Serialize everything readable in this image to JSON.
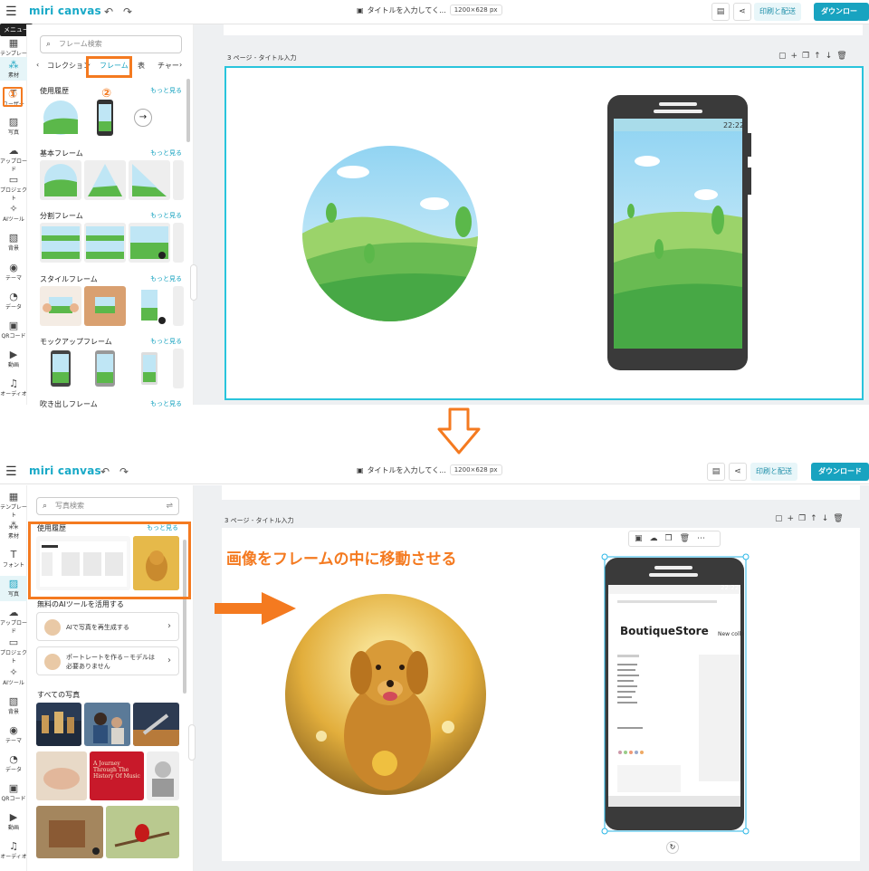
{
  "top": {
    "logo": "miri canvas",
    "title": "タイトルを入力してく...",
    "size": "1200×628 px",
    "print": "印刷と配送",
    "download": "ダウンロード",
    "tooltip": "メニュー"
  },
  "rail_top": [
    "テンプレート",
    "素材",
    "ユーザー",
    "写真",
    "アップロード",
    "プロジェクト",
    "AIツール",
    "背景",
    "テーマ",
    "データ",
    "QRコード",
    "動画",
    "オーディオ"
  ],
  "rail_bottom": [
    "テンプレート",
    "素材",
    "フォント",
    "写真",
    "アップロード",
    "プロジェクト",
    "AIツール",
    "背景",
    "テーマ",
    "データ",
    "QRコード",
    "動画",
    "オーディオ"
  ],
  "panel_top": {
    "search": "フレーム検索",
    "tabs": [
      "コレクション",
      "フレーム",
      "表",
      "チャー"
    ],
    "sections": [
      "使用履歴",
      "基本フレーム",
      "分割フレーム",
      "スタイルフレーム",
      "モックアップフレーム",
      "吹き出しフレーム"
    ],
    "more": "もっと見る",
    "step1": "①",
    "step2": "②"
  },
  "panel_bottom": {
    "search": "写真検索",
    "recent": "使用履歴",
    "more": "もっと見る",
    "ai_heading": "無料のAIツールを活用する",
    "ai_card1": "AIで写真を再生成する",
    "ai_card2": "ポートレートを作る－モデルは必要ありません",
    "all_photos": "すべての写真",
    "book_title": "A Journey Through The History Of Music"
  },
  "canvas": {
    "page_label": "3 ページ - タイトル入力",
    "phone_time": "22:22",
    "annotation": "画像をフレームの中に移動させる",
    "store_title": "BoutiqueStore",
    "store_new": "New colle"
  },
  "colors": {
    "accent": "#18a3c0",
    "orange": "#f47a20",
    "selection": "#29b6e6"
  }
}
